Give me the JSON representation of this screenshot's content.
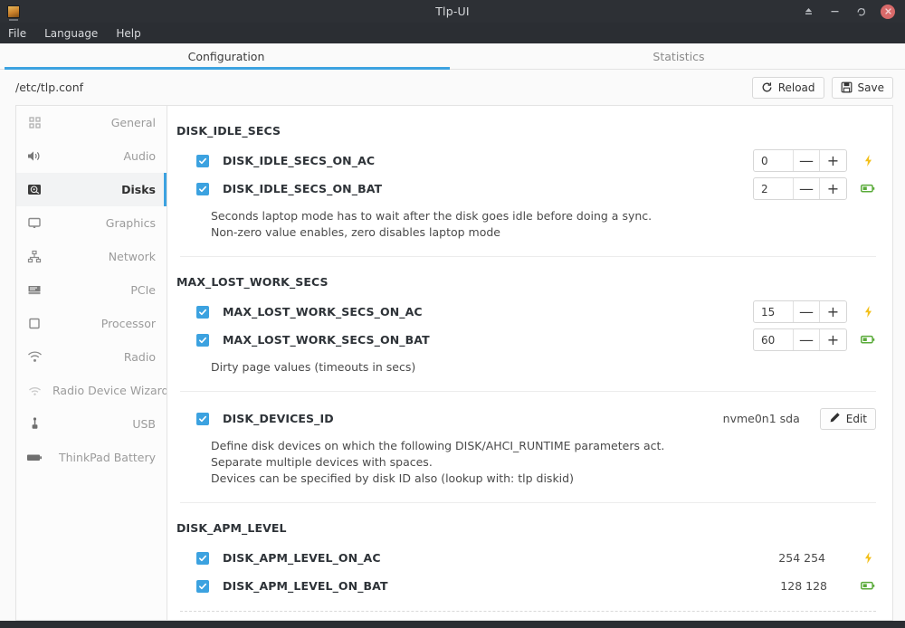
{
  "window": {
    "title": "Tlp-UI",
    "app_icon": "app-icon",
    "controls": {
      "eject_label": "eject",
      "minimize_label": "minimize",
      "maximize_label": "restore",
      "close_label": "close"
    }
  },
  "menubar": {
    "items": [
      {
        "label": "File"
      },
      {
        "label": "Language"
      },
      {
        "label": "Help"
      }
    ]
  },
  "tabs": [
    {
      "label": "Configuration",
      "active": true
    },
    {
      "label": "Statistics",
      "active": false
    }
  ],
  "pathbar": {
    "path": "/etc/tlp.conf",
    "reload_label": "Reload",
    "save_label": "Save"
  },
  "sidebar": {
    "items": [
      {
        "label": "General",
        "icon": "grid-icon",
        "selected": false
      },
      {
        "label": "Audio",
        "icon": "speaker-icon",
        "selected": false
      },
      {
        "label": "Disks",
        "icon": "harddisk-icon",
        "selected": true
      },
      {
        "label": "Graphics",
        "icon": "monitor-icon",
        "selected": false
      },
      {
        "label": "Network",
        "icon": "network-icon",
        "selected": false
      },
      {
        "label": "PCIe",
        "icon": "pcie-card-icon",
        "selected": false
      },
      {
        "label": "Processor",
        "icon": "cpu-icon",
        "selected": false
      },
      {
        "label": "Radio",
        "icon": "wifi-icon",
        "selected": false
      },
      {
        "label": "Radio Device Wizard",
        "icon": "radio-wizard-icon",
        "selected": false
      },
      {
        "label": "USB",
        "icon": "usb-icon",
        "selected": false
      },
      {
        "label": "ThinkPad Battery",
        "icon": "battery-icon",
        "selected": false
      }
    ]
  },
  "sections": [
    {
      "title": "DISK_IDLE_SECS",
      "rows": [
        {
          "label": "DISK_IDLE_SECS_ON_AC",
          "checked": true,
          "control": "spinner",
          "value": "0",
          "minus": "—",
          "plus": "+",
          "power": "ac"
        },
        {
          "label": "DISK_IDLE_SECS_ON_BAT",
          "checked": true,
          "control": "spinner",
          "value": "2",
          "minus": "—",
          "plus": "+",
          "power": "bat"
        }
      ],
      "description": [
        "Seconds laptop mode has to wait after the disk goes idle before doing a sync.",
        "Non-zero value enables, zero disables laptop mode"
      ]
    },
    {
      "title": "MAX_LOST_WORK_SECS",
      "rows": [
        {
          "label": "MAX_LOST_WORK_SECS_ON_AC",
          "checked": true,
          "control": "spinner",
          "value": "15",
          "minus": "—",
          "plus": "+",
          "power": "ac"
        },
        {
          "label": "MAX_LOST_WORK_SECS_ON_BAT",
          "checked": true,
          "control": "spinner",
          "value": "60",
          "minus": "—",
          "plus": "+",
          "power": "bat"
        }
      ],
      "description": [
        "Dirty page values (timeouts in secs)"
      ]
    },
    {
      "title": "",
      "rows": [
        {
          "label": "DISK_DEVICES_ID",
          "checked": true,
          "control": "text-edit",
          "value": "nvme0n1 sda",
          "edit_label": "Edit",
          "power": "none"
        }
      ],
      "description": [
        "Define disk devices on which the following DISK/AHCI_RUNTIME parameters act.",
        "Separate multiple devices with spaces.",
        "Devices can be specified by disk ID also (lookup with: tlp diskid)"
      ]
    },
    {
      "title": "DISK_APM_LEVEL",
      "rows": [
        {
          "label": "DISK_APM_LEVEL_ON_AC",
          "checked": true,
          "control": "text",
          "value": "254 254",
          "power": "ac"
        },
        {
          "label": "DISK_APM_LEVEL_ON_BAT",
          "checked": true,
          "control": "text",
          "value": "128 128",
          "power": "bat"
        }
      ],
      "description": []
    }
  ],
  "colors": {
    "accent": "#3ca2e0",
    "checkbox": "#3ca2e0",
    "ac_icon": "#f3c01b",
    "bat_icon": "#5aab3a",
    "titlebar": "#2d3035",
    "close_button": "#d96a6a"
  }
}
